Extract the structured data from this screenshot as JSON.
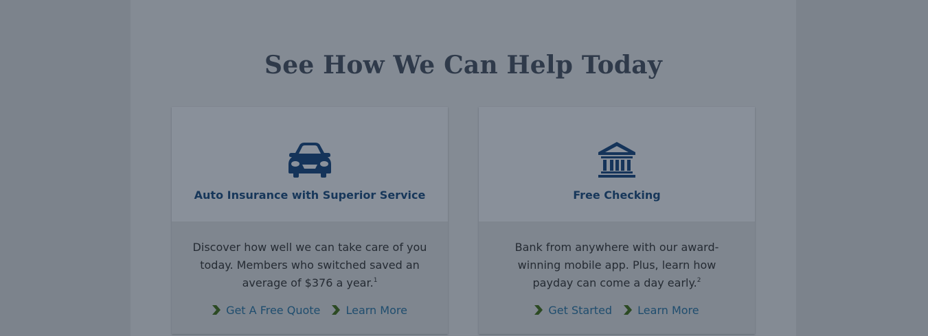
{
  "section": {
    "title": "See How We Can Help Today"
  },
  "cards": [
    {
      "icon": "car-icon",
      "title": "Auto Insurance with Superior Service",
      "body": "Discover how well we can take care of you today. Members who switched saved an average of $376 a year.",
      "footnote": "1",
      "links": [
        "Get A Free Quote",
        "Learn More"
      ]
    },
    {
      "icon": "bank-building-icon",
      "title": "Free Checking",
      "body": "Bank from anywhere with our award-winning mobile app. Plus, learn how payday can come a day early.",
      "footnote": "2",
      "links": [
        "Get Started",
        "Learn More"
      ]
    }
  ],
  "colors": {
    "overlay_bg": "#7c838c",
    "panel_bg": "#848b94",
    "title": "#2f3a4a",
    "card_title": "#17375a",
    "link": "#1f4d6e",
    "chevron": "#2c4a23"
  }
}
